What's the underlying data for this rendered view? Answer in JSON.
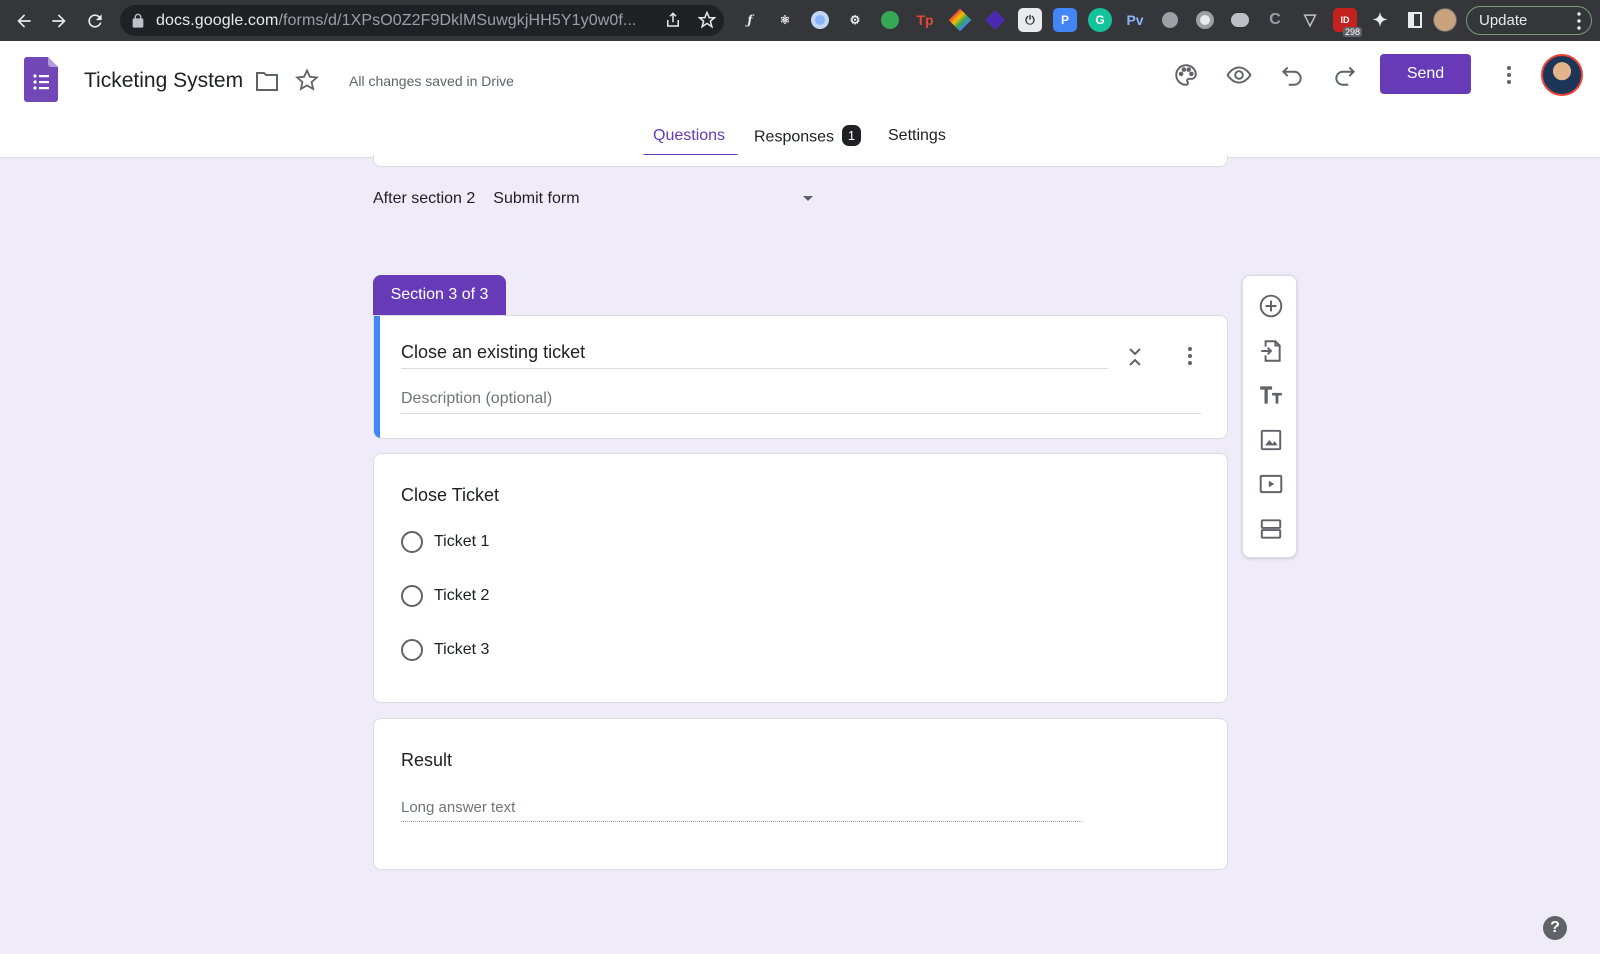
{
  "browser": {
    "url_host": "docs.google.com",
    "url_path": "/forms/d/1XPsO0Z2F9DklMSuwgkjHH5Y1y0w0f...",
    "update_label": "Update",
    "extension_badge": "298"
  },
  "header": {
    "title": "Ticketing System",
    "save_status": "All changes saved in Drive",
    "send_label": "Send"
  },
  "tabs": {
    "questions": "Questions",
    "responses": "Responses",
    "responses_count": "1",
    "settings": "Settings"
  },
  "navigation": {
    "after_section_label": "After section 2",
    "after_section_value": "Submit form"
  },
  "section": {
    "tab_label": "Section 3 of 3",
    "title": "Close an existing ticket",
    "description_placeholder": "Description (optional)"
  },
  "question": {
    "title": "Close Ticket",
    "options": [
      "Ticket 1",
      "Ticket 2",
      "Ticket 3"
    ]
  },
  "result": {
    "title": "Result",
    "placeholder": "Long answer text"
  },
  "help": "?"
}
